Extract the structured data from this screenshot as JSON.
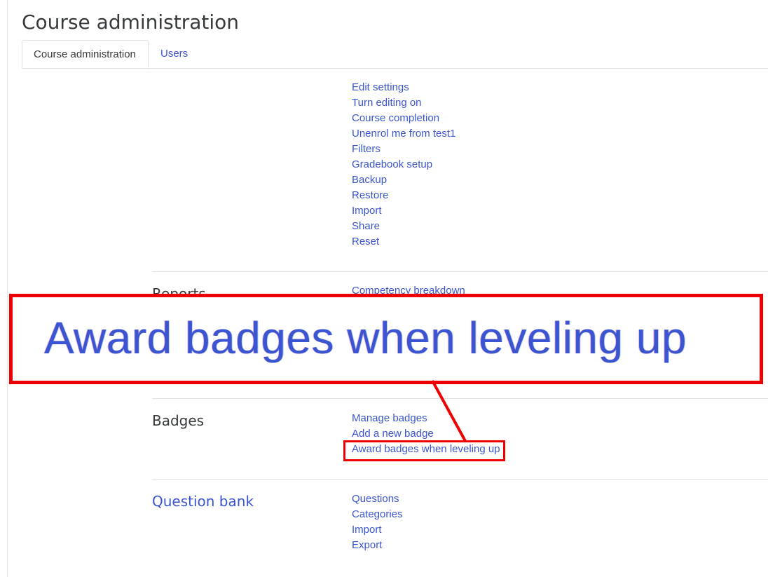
{
  "page": {
    "title": "Course administration"
  },
  "tabs": [
    {
      "label": "Course administration",
      "active": true
    },
    {
      "label": "Users",
      "active": false
    }
  ],
  "course_admin": {
    "links": [
      "Edit settings",
      "Turn editing on",
      "Course completion",
      "Unenrol me from test1",
      "Filters",
      "Gradebook setup",
      "Backup",
      "Restore",
      "Import",
      "Share",
      "Reset"
    ]
  },
  "reports": {
    "heading": "Reports",
    "first_link": "Competency breakdown"
  },
  "badges": {
    "heading": "Badges",
    "links": [
      "Manage badges",
      "Add a new badge",
      "Award badges when leveling up"
    ]
  },
  "question_bank": {
    "heading": "Question bank",
    "links": [
      "Questions",
      "Categories",
      "Import",
      "Export"
    ]
  },
  "callout": {
    "text": "Award badges when leveling up",
    "border_color": "#ee0000"
  },
  "colors": {
    "link": "#3b55d1",
    "text": "#373a3c",
    "highlight": "#ee0000"
  }
}
